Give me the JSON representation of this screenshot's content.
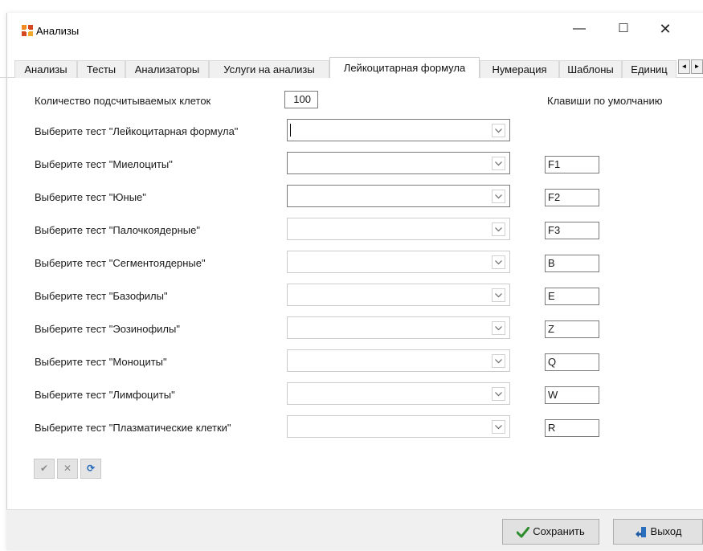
{
  "window": {
    "title": "Анализы",
    "icon": "lab-app-icon",
    "controls": {
      "minimize": "—",
      "maximize": "☐",
      "close": "✕"
    }
  },
  "tabs": [
    {
      "label": "Анализы"
    },
    {
      "label": "Тесты"
    },
    {
      "label": "Анализаторы"
    },
    {
      "label": "Услуги на анализы"
    },
    {
      "label": "Лейкоцитарная формула",
      "active": true
    },
    {
      "label": "Нумерация"
    },
    {
      "label": "Шаблоны"
    },
    {
      "label": "Единиц"
    }
  ],
  "tab_scroll": {
    "left": "◄",
    "right": "►"
  },
  "form": {
    "cell_count_label": "Количество подсчитываемых клеток",
    "cell_count_value": "100",
    "default_keys_header": "Клавиши по умолчанию",
    "rows": [
      {
        "label": "Выберите тест \"Лейкоцитарная формула\"",
        "value": "",
        "key": null
      },
      {
        "label": "Выберите тест \"Миелоциты\"",
        "value": "",
        "key": "F1"
      },
      {
        "label": "Выберите тест \"Юные\"",
        "value": "",
        "key": "F2"
      },
      {
        "label": "Выберите тест \"Палочкоядерные\"",
        "value": "",
        "key": "F3"
      },
      {
        "label": "Выберите тест \"Сегментоядерные\"",
        "value": "",
        "key": "B"
      },
      {
        "label": "Выберите тест \"Базофилы\"",
        "value": "",
        "key": "E"
      },
      {
        "label": "Выберите тест \"Эозинофилы\"",
        "value": "",
        "key": "Z"
      },
      {
        "label": "Выберите тест \"Моноциты\"",
        "value": "",
        "key": "Q"
      },
      {
        "label": "Выберите тест \"Лимфоциты\"",
        "value": "",
        "key": "W"
      },
      {
        "label": "Выберите тест \"Плазматические клетки\"",
        "value": "",
        "key": "R"
      }
    ]
  },
  "mini_toolbar": {
    "apply": "✔",
    "cancel": "✕",
    "refresh": "⟳"
  },
  "footer": {
    "save_label": "Сохранить",
    "exit_label": "Выход"
  },
  "colors": {
    "save_check": "#2e8b2e",
    "exit_icon": "#2a6ebd",
    "refresh_icon": "#2a6ebd"
  }
}
